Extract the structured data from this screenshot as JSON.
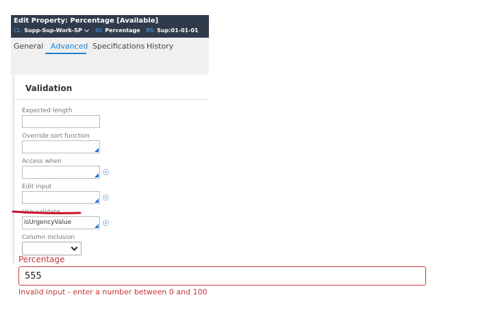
{
  "header": {
    "title": "Edit Property: Percentage [Available]",
    "cl_key": "CL:",
    "cl_value": "Supp-Sup-Work-SP",
    "id_key": "ID:",
    "id_value": "Percentage",
    "rs_key": "RS:",
    "rs_value": "Sup:01-01-01"
  },
  "tabs": [
    {
      "label": "General"
    },
    {
      "label": "Advanced",
      "active": true
    },
    {
      "label": "Specifications"
    },
    {
      "label": "History"
    }
  ],
  "section": {
    "title": "Validation"
  },
  "fields": {
    "expected_length": {
      "label": "Expected length",
      "value": ""
    },
    "override_sort": {
      "label": "Override sort function",
      "value": ""
    },
    "access_when": {
      "label": "Access when",
      "value": ""
    },
    "edit_input": {
      "label": "Edit input",
      "value": ""
    },
    "use_validate": {
      "label": "Use validate",
      "value": "isUrgencyValue"
    },
    "column_inclusion": {
      "label": "Column inclusion",
      "value": ""
    }
  },
  "form": {
    "label": "Percentage",
    "value": "555",
    "error": "Invalid input - enter a number between 0 and 100"
  },
  "colors": {
    "header_bg": "#2f3a4a",
    "accent": "#1b7fd2",
    "error": "#c2373b",
    "annotation": "#c8102e"
  }
}
